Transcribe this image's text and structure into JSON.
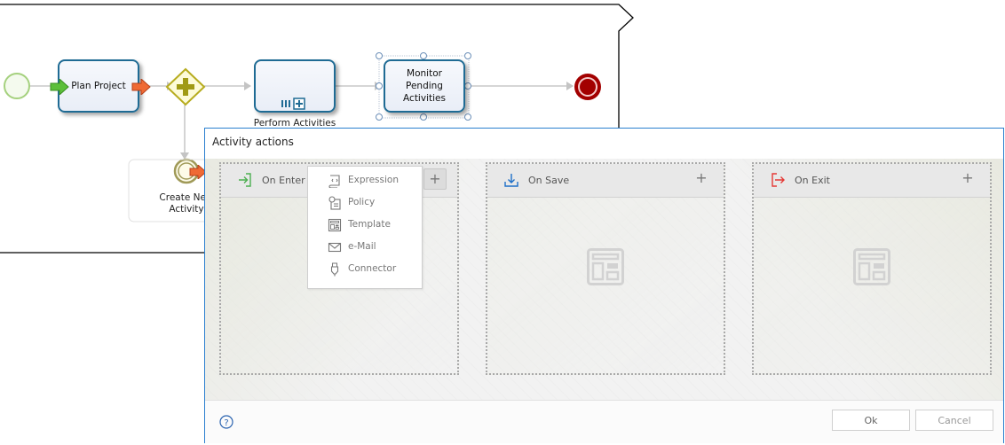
{
  "diagram": {
    "tasks": {
      "plan_project": "Plan Project",
      "perform_activities": "Perform Activities",
      "monitor_pending": [
        "Monitor",
        "Pending",
        "Activities"
      ],
      "create_new_activity": [
        "Create New",
        "Activity"
      ]
    }
  },
  "dialog": {
    "title": "Activity actions",
    "panels": [
      {
        "label": "On Enter",
        "icon": "enter-icon",
        "icon_color": "#4caf50"
      },
      {
        "label": "On Save",
        "icon": "save-download-icon",
        "icon_color": "#1e6fc8"
      },
      {
        "label": "On Exit",
        "icon": "exit-icon",
        "icon_color": "#e53935"
      }
    ],
    "add_label": "+",
    "menu": [
      {
        "label": "Expression",
        "icon": "expression-scroll-icon"
      },
      {
        "label": "Policy",
        "icon": "policy-icon"
      },
      {
        "label": "Template",
        "icon": "template-icon"
      },
      {
        "label": "e-Mail",
        "icon": "email-icon"
      },
      {
        "label": "Connector",
        "icon": "connector-plug-icon"
      }
    ],
    "footer": {
      "help_label": "?",
      "ok_label": "Ok",
      "cancel_label": "Cancel"
    }
  },
  "colors": {
    "accent": "#2a7fcf",
    "task_border": "#1f6b94",
    "end_event": "#a30000",
    "gateway": "#b7ac1e",
    "start_event": "#a5d17e"
  }
}
